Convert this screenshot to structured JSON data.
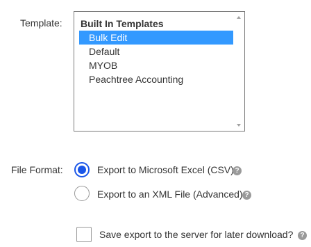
{
  "template": {
    "label": "Template:",
    "group_label": "Built In Templates",
    "options": [
      "Bulk Edit",
      "Default",
      "MYOB",
      "Peachtree Accounting"
    ],
    "selected": "Bulk Edit"
  },
  "file_format": {
    "label": "File Format:",
    "options": [
      {
        "label": "Export to Microsoft Excel (CSV)",
        "checked": true
      },
      {
        "label": "Export to an XML File (Advanced)",
        "checked": false
      }
    ]
  },
  "save_export": {
    "label": "Save export to the server for later download?",
    "checked": false
  },
  "icons": {
    "help": "question-mark-icon",
    "help_glyph": "?"
  },
  "colors": {
    "selection": "#3399ff",
    "radio_accent": "#1a56e8"
  }
}
